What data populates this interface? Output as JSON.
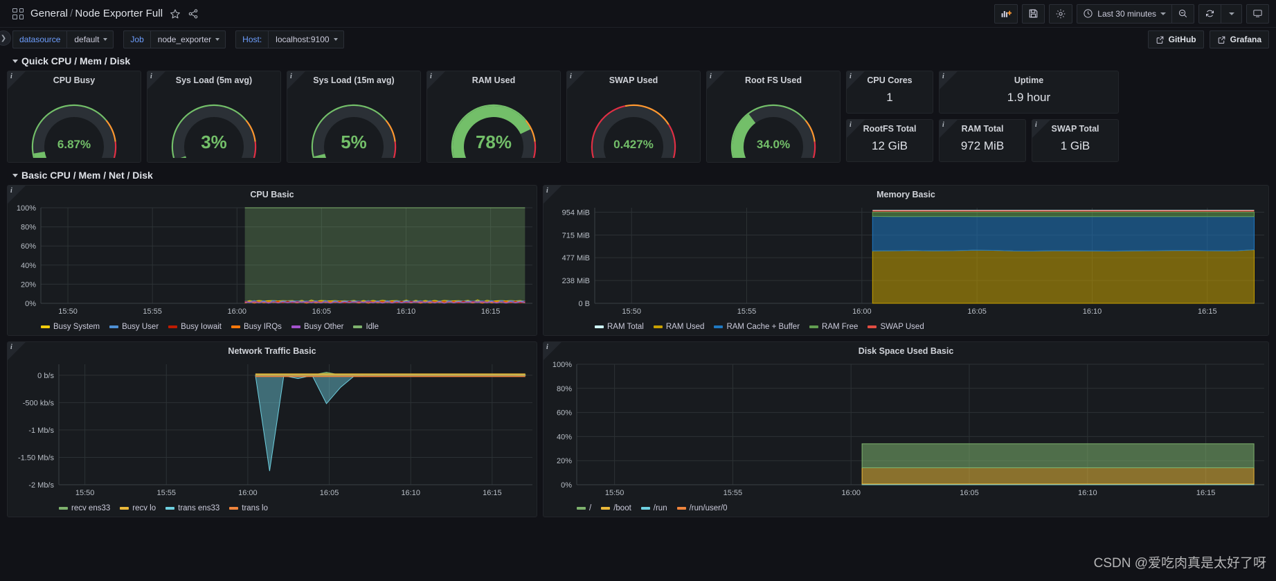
{
  "topnav": {
    "dashboard_icon": "grid-icon",
    "folder": "General",
    "separator": "/",
    "title": "Node Exporter Full",
    "star_icon": "star-icon",
    "share_icon": "share-icon",
    "add_panel_icon": "add-panel-icon",
    "save_icon": "save-icon",
    "settings_icon": "gear-icon",
    "time_icon": "clock-icon",
    "time_range": "Last 30 minutes",
    "zoom_out_icon": "zoom-out-icon",
    "refresh_icon": "refresh-icon",
    "refresh_caret_icon": "chevron-down-icon",
    "kiosk_icon": "tv-icon"
  },
  "variables": [
    {
      "label": "datasource",
      "value": "default"
    },
    {
      "label": "Job",
      "value": "node_exporter"
    },
    {
      "label": "Host:",
      "value": "localhost:9100"
    }
  ],
  "links": [
    {
      "label": "GitHub",
      "icon": "external-link-icon"
    },
    {
      "label": "Grafana",
      "icon": "external-link-icon"
    }
  ],
  "rows": [
    {
      "title": "Quick CPU / Mem / Disk"
    },
    {
      "title": "Basic CPU / Mem / Net / Disk"
    }
  ],
  "gauges": [
    {
      "title": "CPU Busy",
      "value": "6.87%",
      "pct": 6.87,
      "color": "#73bf69"
    },
    {
      "title": "Sys Load (5m avg)",
      "value": "3%",
      "pct": 3,
      "color": "#73bf69"
    },
    {
      "title": "Sys Load (15m avg)",
      "value": "5%",
      "pct": 5,
      "color": "#73bf69"
    },
    {
      "title": "RAM Used",
      "value": "78%",
      "pct": 78,
      "color": "#73bf69"
    },
    {
      "title": "SWAP Used",
      "value": "0.427%",
      "pct": 0.427,
      "color": "#73bf69"
    },
    {
      "title": "Root FS Used",
      "value": "34.0%",
      "pct": 34.0,
      "color": "#73bf69"
    }
  ],
  "stats": [
    {
      "title": "CPU Cores",
      "value": "1"
    },
    {
      "title": "Uptime",
      "value": "1.9 hour"
    },
    {
      "title": "RootFS Total",
      "value": "12 GiB"
    },
    {
      "title": "RAM Total",
      "value": "972 MiB"
    },
    {
      "title": "SWAP Total",
      "value": "1 GiB"
    }
  ],
  "chart_data": [
    {
      "type": "area",
      "title": "CPU Basic",
      "xlabel": "",
      "ylabel": "",
      "ylim": [
        0,
        100
      ],
      "yticks": [
        "0%",
        "20%",
        "40%",
        "60%",
        "80%",
        "100%"
      ],
      "ytick_values": [
        0,
        20,
        40,
        60,
        80,
        100
      ],
      "xticks": [
        "15:50",
        "15:55",
        "16:00",
        "16:05",
        "16:10",
        "16:15"
      ],
      "grid": true,
      "legend_position": "bottom",
      "data_start_x": "15:58",
      "series": [
        {
          "name": "Busy System",
          "color": "#f2cc0c",
          "values": [
            1.5,
            1.2,
            1.8,
            1.4,
            1.6,
            1.3,
            1.7,
            1.5,
            1.4,
            1.9,
            1.3,
            1.6,
            1.5,
            1.2,
            1.8,
            1.4,
            1.5,
            1.7,
            1.3,
            1.6
          ]
        },
        {
          "name": "Busy User",
          "color": "#4e90d4",
          "values": [
            1.0,
            0.9,
            1.2,
            1.1,
            1.0,
            0.8,
            1.3,
            1.1,
            0.9,
            1.4,
            1.0,
            1.2,
            1.1,
            0.9,
            1.3,
            1.0,
            1.1,
            1.2,
            0.9,
            1.1
          ]
        },
        {
          "name": "Busy Iowait",
          "color": "#bf1b00",
          "values": [
            0.4,
            0.3,
            0.5,
            0.4,
            0.3,
            0.2,
            0.6,
            0.4,
            0.3,
            0.5,
            0.4,
            0.3,
            0.4,
            0.3,
            0.5,
            0.4,
            0.3,
            0.4,
            0.2,
            0.4
          ]
        },
        {
          "name": "Busy IRQs",
          "color": "#ff780a",
          "values": [
            0.1,
            0.1,
            0.1,
            0.1,
            0.1,
            0.1,
            0.1,
            0.1,
            0.1,
            0.1,
            0.1,
            0.1,
            0.1,
            0.1,
            0.1,
            0.1,
            0.1,
            0.1,
            0.1,
            0.1
          ]
        },
        {
          "name": "Busy Other",
          "color": "#a352cc",
          "values": [
            0.1,
            0.1,
            0.1,
            0.1,
            0.1,
            0.1,
            0.1,
            0.1,
            0.1,
            0.1,
            0.1,
            0.1,
            0.1,
            0.1,
            0.1,
            0.1,
            0.1,
            0.1,
            0.1,
            0.1
          ]
        },
        {
          "name": "Idle",
          "color": "#7eb26d",
          "values": [
            97,
            97.3,
            96.5,
            97,
            97.1,
            97.6,
            96.3,
            96.9,
            97.3,
            96.2,
            97.2,
            96.9,
            96.9,
            97.5,
            96.3,
            97,
            97,
            96.6,
            97.5,
            96.9
          ]
        }
      ]
    },
    {
      "type": "area",
      "title": "Memory Basic",
      "xlabel": "",
      "ylabel": "",
      "ylim": [
        0,
        1000
      ],
      "yticks": [
        "0 B",
        "238 MiB",
        "477 MiB",
        "715 MiB",
        "954 MiB"
      ],
      "ytick_values": [
        0,
        238,
        477,
        715,
        954
      ],
      "xticks": [
        "15:50",
        "15:55",
        "16:00",
        "16:05",
        "16:10",
        "16:15"
      ],
      "grid": true,
      "legend_position": "bottom",
      "data_start_x": "15:58",
      "series": [
        {
          "name": "RAM Total",
          "color": "#cffaff",
          "values": [
            972,
            972,
            972,
            972,
            972,
            972,
            972,
            972,
            972,
            972,
            972,
            972,
            972,
            972,
            972,
            972,
            972,
            972,
            972,
            972
          ]
        },
        {
          "name": "RAM Used",
          "color": "#c7a000",
          "values": [
            548,
            550,
            552,
            549,
            551,
            556,
            554,
            548,
            547,
            550,
            549,
            548,
            547,
            549,
            551,
            553,
            552,
            550,
            549,
            560
          ]
        },
        {
          "name": "RAM Cache + Buffer",
          "color": "#1f78c1",
          "values": [
            362,
            358,
            356,
            360,
            358,
            352,
            354,
            360,
            361,
            358,
            359,
            360,
            361,
            359,
            357,
            355,
            356,
            358,
            359,
            348
          ]
        },
        {
          "name": "RAM Free",
          "color": "#629e51",
          "values": [
            44,
            46,
            46,
            45,
            45,
            46,
            46,
            46,
            46,
            46,
            46,
            46,
            46,
            46,
            46,
            46,
            46,
            46,
            46,
            46
          ]
        },
        {
          "name": "SWAP Used",
          "color": "#e24d42",
          "values": [
            4.4,
            4.4,
            4.4,
            4.4,
            4.4,
            4.4,
            4.4,
            4.4,
            4.4,
            4.4,
            4.4,
            4.4,
            4.4,
            4.4,
            4.4,
            4.4,
            4.4,
            4.4,
            4.4,
            4.4
          ]
        }
      ]
    },
    {
      "type": "area",
      "title": "Network Traffic Basic",
      "xlabel": "",
      "ylabel": "",
      "ylim": [
        -2000,
        200
      ],
      "yticks": [
        "-2 Mb/s",
        "-1.50 Mb/s",
        "-1 Mb/s",
        "-500 kb/s",
        "0 b/s"
      ],
      "ytick_values": [
        -2000,
        -1500,
        -1000,
        -500,
        0
      ],
      "xticks": [
        "15:50",
        "15:55",
        "16:00",
        "16:05",
        "16:10",
        "16:15"
      ],
      "grid": true,
      "legend_position": "bottom",
      "data_start_x": "15:58",
      "series": [
        {
          "name": "recv ens33",
          "color": "#7eb26d",
          "values": [
            0,
            8,
            2,
            0,
            1,
            55,
            3,
            1,
            0,
            0,
            0,
            0,
            0,
            0,
            0,
            0,
            0,
            0,
            0,
            9
          ]
        },
        {
          "name": "recv lo",
          "color": "#eab839",
          "values": [
            0,
            0,
            0,
            0,
            0,
            0,
            0,
            0,
            0,
            0,
            0,
            0,
            0,
            0,
            0,
            0,
            0,
            0,
            0,
            0
          ]
        },
        {
          "name": "trans ens33",
          "color": "#6ed0e0",
          "values": [
            0,
            -1750,
            -10,
            -60,
            -5,
            -520,
            -220,
            -5,
            0,
            0,
            0,
            0,
            0,
            0,
            0,
            0,
            0,
            0,
            0,
            -6
          ]
        },
        {
          "name": "trans lo",
          "color": "#ef843c",
          "values": [
            0,
            0,
            0,
            0,
            0,
            0,
            0,
            0,
            0,
            0,
            0,
            0,
            0,
            0,
            0,
            0,
            0,
            0,
            0,
            0
          ]
        }
      ]
    },
    {
      "type": "area",
      "title": "Disk Space Used Basic",
      "xlabel": "",
      "ylabel": "",
      "ylim": [
        0,
        100
      ],
      "yticks": [
        "0%",
        "20%",
        "40%",
        "60%",
        "80%",
        "100%"
      ],
      "ytick_values": [
        0,
        20,
        40,
        60,
        80,
        100
      ],
      "xticks": [
        "15:50",
        "15:55",
        "16:00",
        "16:05",
        "16:10",
        "16:15"
      ],
      "grid": true,
      "legend_position": "bottom",
      "data_start_x": "15:58",
      "series": [
        {
          "name": "/",
          "color": "#7eb26d",
          "values": [
            34,
            34,
            34,
            34,
            34,
            34,
            34,
            34,
            34,
            34,
            34,
            34,
            34,
            34,
            34,
            34,
            34,
            34,
            34,
            34
          ]
        },
        {
          "name": "/boot",
          "color": "#eab839",
          "values": [
            13.5,
            13.5,
            13.5,
            13.5,
            13.5,
            13.5,
            13.5,
            13.5,
            13.5,
            13.5,
            13.5,
            13.5,
            13.5,
            13.5,
            13.5,
            13.5,
            13.5,
            13.5,
            13.5,
            13.5
          ]
        },
        {
          "name": "/run",
          "color": "#6ed0e0",
          "values": [
            0.6,
            0.6,
            0.6,
            0.6,
            0.6,
            0.6,
            0.6,
            0.6,
            0.6,
            0.6,
            0.6,
            0.6,
            0.6,
            0.6,
            0.6,
            0.6,
            0.6,
            0.6,
            0.6,
            0.6
          ]
        },
        {
          "name": "/run/user/0",
          "color": "#ef843c",
          "values": [
            0,
            0,
            0,
            0,
            0,
            0,
            0,
            0,
            0,
            0,
            0,
            0,
            0,
            0,
            0,
            0,
            0,
            0,
            0,
            0
          ]
        }
      ]
    }
  ],
  "watermark": "CSDN @爱吃肉真是太好了呀"
}
